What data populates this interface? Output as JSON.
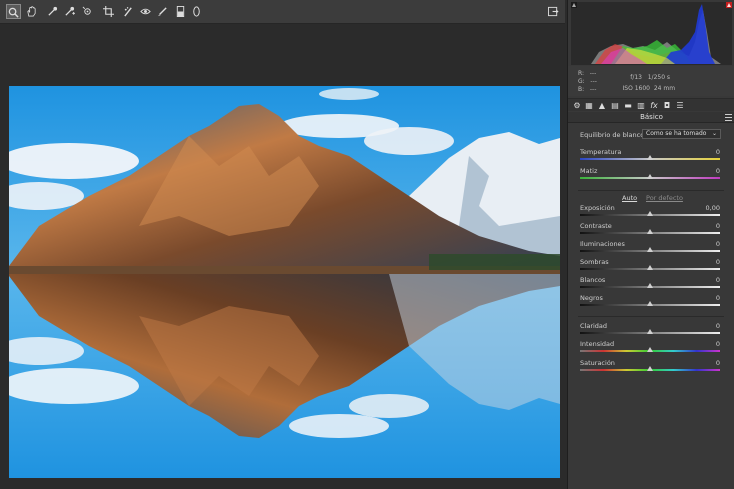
{
  "toolbar": {
    "tools": [
      {
        "icon": "zoom-icon",
        "glyph": "🔍"
      },
      {
        "icon": "hand-icon",
        "glyph": "✋"
      },
      {
        "icon": "white-balance-icon",
        "glyph": "✎"
      },
      {
        "icon": "color-sampler-icon",
        "glyph": "✎"
      },
      {
        "icon": "target-adjust-icon",
        "glyph": "◎"
      },
      {
        "icon": "crop-icon",
        "glyph": "⌗"
      },
      {
        "icon": "spot-removal-icon",
        "glyph": "✐"
      },
      {
        "icon": "red-eye-icon",
        "glyph": "◉"
      },
      {
        "icon": "adjustment-brush-icon",
        "glyph": "✏"
      },
      {
        "icon": "graduated-filter-icon",
        "glyph": "▥"
      },
      {
        "icon": "radial-filter-icon",
        "glyph": "○"
      }
    ],
    "export_icon": "export-icon"
  },
  "info": {
    "r_label": "R:",
    "r_value": "---",
    "g_label": "G:",
    "g_value": "---",
    "b_label": "B:",
    "b_value": "---",
    "aperture": "f/13",
    "shutter": "1/250 s",
    "iso": "ISO 1600",
    "focal": "24 mm"
  },
  "panel": {
    "section_title": "Básico",
    "white_balance_label": "Equilibrio de blancos:",
    "white_balance_value": "Como se ha tomado",
    "auto_label": "Auto",
    "default_label": "Por defecto",
    "sliders": [
      {
        "label": "Temperatura",
        "value": "0",
        "position": 0.5,
        "track": "temperature"
      },
      {
        "label": "Matiz",
        "value": "0",
        "position": 0.5,
        "track": "tint"
      },
      {
        "label": "Exposición",
        "value": "0,00",
        "position": 0.5,
        "track": "gray"
      },
      {
        "label": "Contraste",
        "value": "0",
        "position": 0.5,
        "track": "gray"
      },
      {
        "label": "Iluminaciones",
        "value": "0",
        "position": 0.5,
        "track": "gray"
      },
      {
        "label": "Sombras",
        "value": "0",
        "position": 0.5,
        "track": "gray"
      },
      {
        "label": "Blancos",
        "value": "0",
        "position": 0.5,
        "track": "gray"
      },
      {
        "label": "Negros",
        "value": "0",
        "position": 0.5,
        "track": "gray"
      },
      {
        "label": "Claridad",
        "value": "0",
        "position": 0.5,
        "track": "gray"
      },
      {
        "label": "Intensidad",
        "value": "0",
        "position": 0.5,
        "track": "rainbow"
      },
      {
        "label": "Saturación",
        "value": "0",
        "position": 0.5,
        "track": "rainbow"
      }
    ]
  },
  "tabs": [
    "basic-tab-icon",
    "tone-curve-tab-icon",
    "detail-tab-icon",
    "hsl-tab-icon",
    "split-toning-tab-icon",
    "lens-tab-icon",
    "effects-tab-icon",
    "camera-calibration-tab-icon",
    "presets-tab-icon"
  ]
}
